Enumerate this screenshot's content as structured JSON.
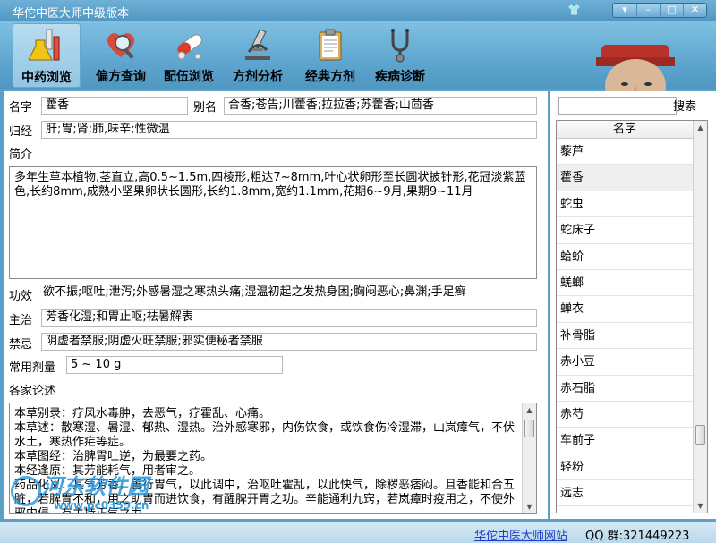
{
  "window": {
    "title": "华佗中医大师中级版本"
  },
  "toolbar": {
    "tabs": [
      {
        "label": "中药浏览",
        "icon": "flask-icon"
      },
      {
        "label": "偏方查询",
        "icon": "heart-search-icon"
      },
      {
        "label": "配伍浏览",
        "icon": "pill-icon"
      },
      {
        "label": "方剂分析",
        "icon": "microscope-icon"
      },
      {
        "label": "经典方剂",
        "icon": "clipboard-icon"
      },
      {
        "label": "疾病诊断",
        "icon": "stethoscope-icon"
      }
    ]
  },
  "herb": {
    "name_label": "名字",
    "name": "藿香",
    "alias_label": "别名",
    "alias": "合香;苍告;川藿香;拉拉香;苏藿香;山茴香",
    "meridian_label": "归经",
    "meridian": "肝;胃;肾;肺,味辛;性微温",
    "intro_label": "简介",
    "intro": "多年生草本植物,茎直立,高0.5~1.5m,四棱形,粗达7~8mm,叶心状卵形至长圆状披针形,花冠淡紫蓝色,长约8mm,成熟小坚果卵状长圆形,长约1.8mm,宽约1.1mm,花期6~9月,果期9~11月",
    "effect_label": "功效",
    "effect": "欲不振;呕吐;泄泻;外感暑湿之寒热头痛;湿温初起之发热身困;胸闷恶心;鼻渊;手足癣",
    "indication_label": "主治",
    "indication": "芳香化湿;和胃止呕;祛暑解表",
    "taboo_label": "禁忌",
    "taboo": "阴虚者禁服;阴虚火旺禁服;邪实便秘者禁服",
    "dose_label": "常用剂量",
    "dose": "5 ~ 10 g",
    "commentary_label": "各家论述",
    "commentary": [
      "本草别录：疗风水毒肿，去恶气，疗霍乱、心痛。",
      "本草述：散寒湿、暑湿、郁热、湿热。治外感寒邪，内伤饮食，或饮食伤冷湿滞，山岚瘴气，不伏水土，寒热作疟等症。",
      "本草图经：治脾胃吐逆，为最要之药。",
      "本经逢原：其芳能耗气，用者审之。",
      "药品化义：其气芳香，善行胃气，以此调中，治呕吐霍乱，以此快气，除秽恶痞闷。且香能和合五脏，若脾胃不和，用之助胃而进饮食，有醒脾开胃之功。辛能通利九窍，若岚瘴时疫用之，不使外邪内侵，有主持正气之力。"
    ]
  },
  "sidebar": {
    "search_button": "搜索",
    "list_header": "名字",
    "items": [
      "藜芦",
      "藿香",
      "蛇虫",
      "蛇床子",
      "蛤蚧",
      "蜣螂",
      "蝉衣",
      "补骨脂",
      "赤小豆",
      "赤石脂",
      "赤芍",
      "车前子",
      "轻粉",
      "远志"
    ],
    "selected_index": 1
  },
  "status": {
    "site_link": "华佗中医大师网站",
    "qq": "QQ 群:321449223"
  },
  "watermark": {
    "text": "河东软件园",
    "url": "www.pc0359.cn"
  }
}
